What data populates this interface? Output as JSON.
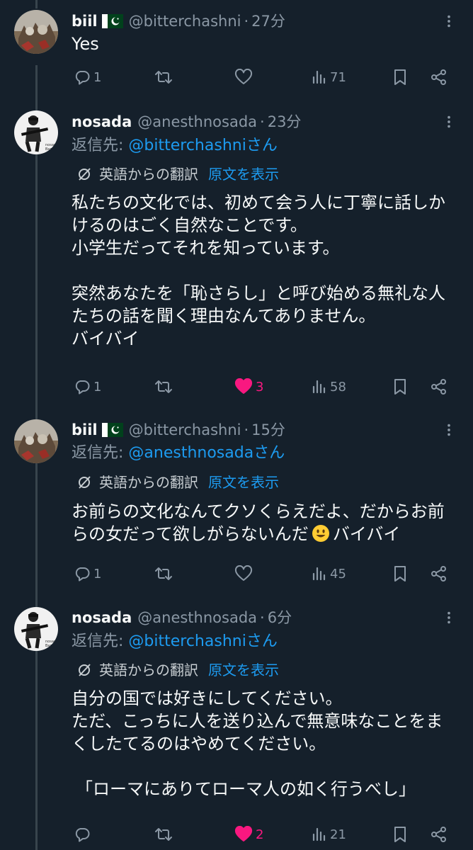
{
  "tweets": [
    {
      "name": "biil",
      "flag_icon": "pakistan-flag-icon",
      "handle": "@bitterchashni",
      "separator": "·",
      "time": "27分",
      "body": [
        "Yes"
      ],
      "stats": {
        "replies": "1",
        "reposts": "",
        "likes": "",
        "views": "71"
      },
      "liked": false
    },
    {
      "name": "nosada",
      "handle": "@anesthnosada",
      "separator": "·",
      "time": "23分",
      "reply_label": "返信先: ",
      "reply_user": "@bitterchashniさん",
      "translate_label": "英語からの翻訳",
      "translate_link": "原文を表示",
      "body": [
        "私たちの文化では、初めて会う人に丁寧に話しかけるのはごく自然なことです。",
        "小学生だってそれを知っています。",
        "",
        "突然あなたを「恥さらし」と呼び始める無礼な人たちの話を聞く理由なんてありません。",
        "バイバイ"
      ],
      "stats": {
        "replies": "1",
        "reposts": "",
        "likes": "3",
        "views": "58"
      },
      "liked": true
    },
    {
      "name": "biil",
      "flag_icon": "pakistan-flag-icon",
      "handle": "@bitterchashni",
      "separator": "·",
      "time": "15分",
      "reply_label": "返信先: ",
      "reply_user": "@anesthnosadaさん",
      "translate_label": "英語からの翻訳",
      "translate_link": "原文を表示",
      "body_a": "お前らの文化なんてクソくらえだよ、だからお前らの女だって欲しがらないんだ",
      "emoji_icon": "smiley-emoji-icon",
      "body_b": "バイバイ",
      "stats": {
        "replies": "1",
        "reposts": "",
        "likes": "",
        "views": "45"
      },
      "liked": false
    },
    {
      "name": "nosada",
      "handle": "@anesthnosada",
      "separator": "·",
      "time": "6分",
      "reply_label": "返信先: ",
      "reply_user": "@bitterchashniさん",
      "translate_label": "英語からの翻訳",
      "translate_link": "原文を表示",
      "body": [
        "自分の国では好きにしてください。",
        "ただ、こっちに人を送り込んで無意味なことをまくしたてるのはやめてください。",
        "",
        "「ローマにありてローマ人の如く行うべし」"
      ],
      "stats": {
        "replies": "",
        "reposts": "",
        "likes": "2",
        "views": "21"
      },
      "liked": true
    }
  ],
  "icons": {
    "reply": "reply-icon",
    "repost": "repost-icon",
    "like": "heart-icon",
    "views": "views-icon",
    "bookmark": "bookmark-icon",
    "share": "share-icon",
    "more": "more-icon",
    "translate": "translate-icon"
  },
  "colors": {
    "background": "#15202b",
    "link": "#1d9bf0",
    "muted": "#8b98a5",
    "like": "#f91880",
    "thread_line": "#38444d"
  }
}
